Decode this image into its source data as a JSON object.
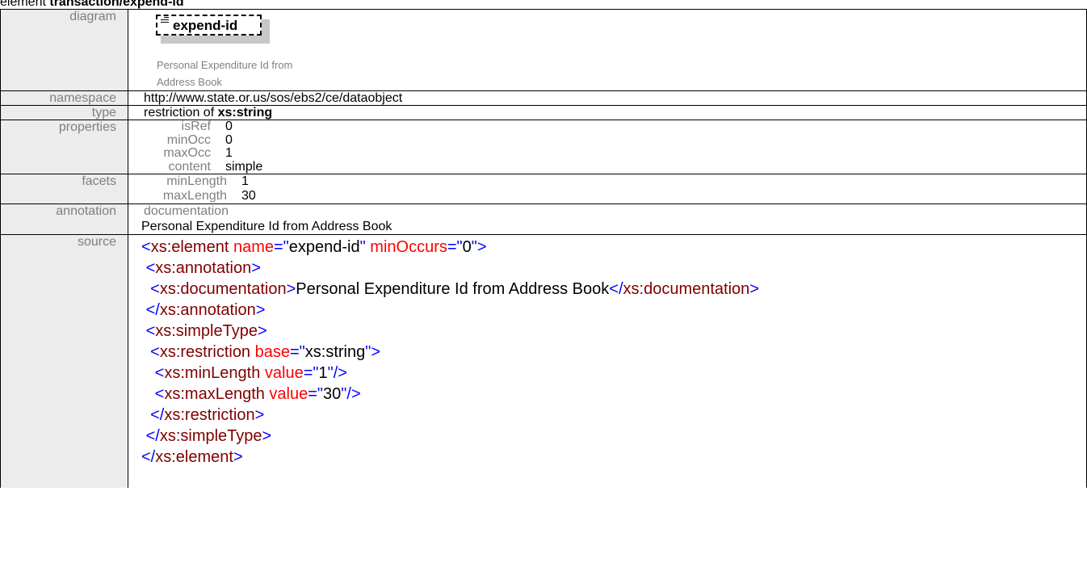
{
  "title": {
    "prefix": "element ",
    "name": "transaction/expend-id"
  },
  "labels": {
    "diagram": "diagram",
    "namespace": "namespace",
    "type": "type",
    "properties": "properties",
    "facets": "facets",
    "annotation": "annotation",
    "source": "source"
  },
  "diagram": {
    "element_name": "expend-id",
    "documentation_line1": "Personal Expenditure Id from",
    "documentation_line2": "Address Book"
  },
  "namespace": "http://www.state.or.us/sos/ebs2/ce/dataobject",
  "type": {
    "prefix": "restriction of ",
    "base": "xs:string"
  },
  "properties": [
    {
      "key": "isRef",
      "value": "0"
    },
    {
      "key": "minOcc",
      "value": "0"
    },
    {
      "key": "maxOcc",
      "value": "1"
    },
    {
      "key": "content",
      "value": "simple"
    }
  ],
  "facets": [
    {
      "key": "minLength",
      "value": "1"
    },
    {
      "key": "maxLength",
      "value": "30"
    }
  ],
  "annotation": {
    "label": "documentation",
    "text": "Personal Expenditure Id from Address Book"
  },
  "source": {
    "l1": {
      "open": "<",
      "tag": "xs:element",
      "attr1": " name",
      "eq1": "=\"",
      "val1": "expend-id",
      "q1": "\"",
      "attr2": " minOccurs",
      "eq2": "=\"",
      "val2": "0",
      "close": "\">"
    },
    "l2": {
      "indent": " ",
      "open": "<",
      "tag": "xs:annotation",
      "close": ">"
    },
    "l3": {
      "indent": "  ",
      "open": "<",
      "tag": "xs:documentation",
      "gt": ">",
      "text": "Personal Expenditure Id from Address Book",
      "endopen": "</",
      "endtag": "xs:documentation",
      "close": ">"
    },
    "l4": {
      "indent": " ",
      "open": "</",
      "tag": "xs:annotation",
      "close": ">"
    },
    "l5": {
      "indent": " ",
      "open": "<",
      "tag": "xs:simpleType",
      "close": ">"
    },
    "l6": {
      "indent": "  ",
      "open": "<",
      "tag": "xs:restriction",
      "attr": " base",
      "eq": "=\"",
      "val": "xs:string",
      "close": "\">"
    },
    "l7": {
      "indent": "   ",
      "open": "<",
      "tag": "xs:minLength",
      "attr": " value",
      "eq": "=\"",
      "val": "1",
      "close": "\"/>"
    },
    "l8": {
      "indent": "   ",
      "open": "<",
      "tag": "xs:maxLength",
      "attr": " value",
      "eq": "=\"",
      "val": "30",
      "close": "\"/>"
    },
    "l9": {
      "indent": "  ",
      "open": "</",
      "tag": "xs:restriction",
      "close": ">"
    },
    "l10": {
      "indent": " ",
      "open": "</",
      "tag": "xs:simpleType",
      "close": ">"
    },
    "l11": {
      "indent": "",
      "open": "</",
      "tag": "xs:element",
      "close": ">"
    }
  }
}
